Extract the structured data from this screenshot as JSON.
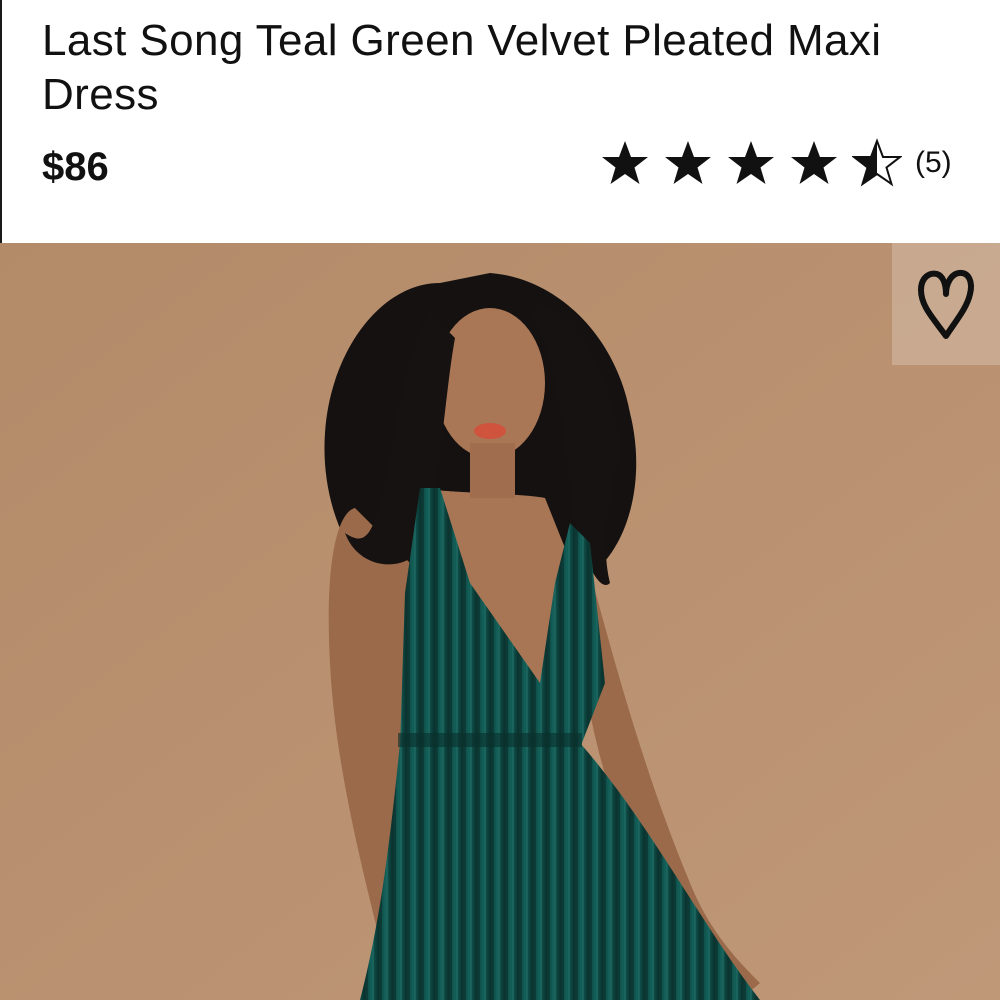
{
  "product": {
    "title": "Last Song Teal Green Velvet Pleated Maxi Dress",
    "price": "$86",
    "rating": {
      "value": 4.5,
      "max": 5,
      "review_count_label": "(5)"
    }
  },
  "icons": {
    "star": "star-icon",
    "half_star": "half-star-icon",
    "wishlist": "heart-icon"
  },
  "colors": {
    "photo_background": "#b8906e",
    "dress": "#0f4a44",
    "text": "#111111"
  }
}
